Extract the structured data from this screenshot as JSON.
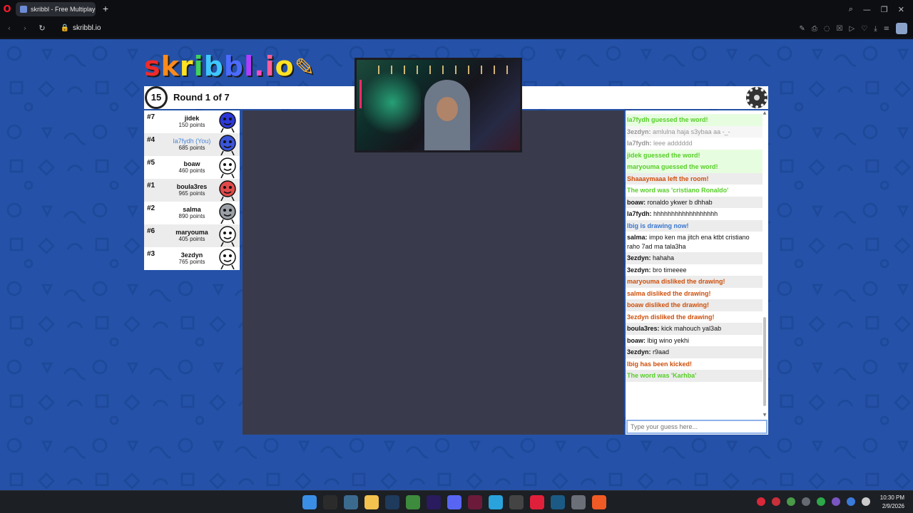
{
  "browser": {
    "tab_title": "skribbl - Free Multiplayer",
    "new_tab_symbol": "+",
    "url": "skribbl.io",
    "opera_logo": "O",
    "icons": [
      "back-arrow-icon",
      "forward-arrow-icon",
      "reload-icon",
      "lock-icon",
      "search-icon",
      "minimize-icon",
      "maximize-icon",
      "close-icon"
    ],
    "nav": {
      "back": "‹",
      "forward": "›",
      "reload": "↻",
      "lock": "🔒"
    },
    "win": {
      "search": "⌕",
      "min": "—",
      "max": "❐",
      "close": "✕"
    },
    "ext": [
      "✎",
      "⎙",
      "◌",
      "☒",
      "▷",
      "♡",
      "⤓",
      "≡"
    ]
  },
  "game": {
    "logo_letters": [
      {
        "ch": "s",
        "color": "#ef2a2a"
      },
      {
        "ch": "k",
        "color": "#ff8a1c"
      },
      {
        "ch": "r",
        "color": "#ffe223"
      },
      {
        "ch": "i",
        "color": "#3fd35a"
      },
      {
        "ch": "b",
        "color": "#3ec7ff"
      },
      {
        "ch": "b",
        "color": "#4c6bff"
      },
      {
        "ch": "l",
        "color": "#b13cff"
      },
      {
        "ch": ".",
        "color": "#ff4cc2"
      },
      {
        "ch": "i",
        "color": "#ff5d9a"
      },
      {
        "ch": "o",
        "color": "#ffe223"
      }
    ],
    "logo_pencil": "✎",
    "timer": "15",
    "round_text": "Round 1 of 7",
    "players": [
      {
        "rank": "#7",
        "name": "jidek",
        "points": "150 points",
        "you": false,
        "avatar_color": "#2e38d8"
      },
      {
        "rank": "#4",
        "name": "la7fydh (You)",
        "points": "685 points",
        "you": true,
        "avatar_color": "#3b55d9"
      },
      {
        "rank": "#5",
        "name": "boaw",
        "points": "460 points",
        "you": false,
        "avatar_color": "#ffffff"
      },
      {
        "rank": "#1",
        "name": "boula3res",
        "points": "965 points",
        "you": false,
        "avatar_color": "#e24a4a"
      },
      {
        "rank": "#2",
        "name": "salma",
        "points": "890 points",
        "you": false,
        "avatar_color": "#9aa0a6"
      },
      {
        "rank": "#6",
        "name": "maryouma",
        "points": "405 points",
        "you": false,
        "avatar_color": "#ffffff"
      },
      {
        "rank": "#3",
        "name": "3ezdyn",
        "points": "765 points",
        "you": false,
        "avatar_color": "#ffffff"
      }
    ],
    "chat": [
      {
        "user": "",
        "text": "la7fydh guessed the word!",
        "style": "green"
      },
      {
        "user": "3ezdyn:",
        "text": "amlulna haja s3ybaa aa -_-",
        "style": "faded"
      },
      {
        "user": "la7fydh:",
        "text": "leee adddddd",
        "style": "faded"
      },
      {
        "user": "",
        "text": "jidek guessed the word!",
        "style": "green"
      },
      {
        "user": "",
        "text": "maryouma guessed the word!",
        "style": "green"
      },
      {
        "user": "",
        "text": "Shaaaymaaa left the room!",
        "style": "red"
      },
      {
        "user": "",
        "text": "The word was 'cristiano Ronaldo'",
        "style": "green-text"
      },
      {
        "user": "boaw:",
        "text": "ronaldo ykwer b dhhab",
        "style": "normal"
      },
      {
        "user": "la7fydh:",
        "text": "hhhhhhhhhhhhhhhhhh",
        "style": "normal"
      },
      {
        "user": "",
        "text": "lbig is drawing now!",
        "style": "blue"
      },
      {
        "user": "salma:",
        "text": "impo ken ma jitch ena ktbt cristiano raho 7ad ma tala3ha",
        "style": "normal"
      },
      {
        "user": "3ezdyn:",
        "text": "hahaha",
        "style": "normal"
      },
      {
        "user": "3ezdyn:",
        "text": "bro timeeee",
        "style": "normal"
      },
      {
        "user": "",
        "text": "maryouma disliked the drawing!",
        "style": "red"
      },
      {
        "user": "",
        "text": "salma disliked the drawing!",
        "style": "red"
      },
      {
        "user": "",
        "text": "boaw disliked the drawing!",
        "style": "red"
      },
      {
        "user": "",
        "text": "3ezdyn disliked the drawing!",
        "style": "red"
      },
      {
        "user": "boula3res:",
        "text": "kick mahouch yal3ab",
        "style": "normal"
      },
      {
        "user": "boaw:",
        "text": "lbig wino yekhi",
        "style": "normal"
      },
      {
        "user": "3ezdyn:",
        "text": "r9aad",
        "style": "normal"
      },
      {
        "user": "",
        "text": "lbig has been kicked!",
        "style": "red"
      },
      {
        "user": "",
        "text": "The word was 'Karhba'",
        "style": "green-text"
      }
    ],
    "guess_placeholder": "Type your guess here..."
  },
  "taskbar": {
    "time": "10:30 PM",
    "date": "2/9/2026",
    "apps": [
      {
        "name": "windows-start-icon",
        "color": "#3a8ee6"
      },
      {
        "name": "epic-games-icon",
        "color": "#2b2b2b"
      },
      {
        "name": "snipping-tool-icon",
        "color": "#3b6a8f"
      },
      {
        "name": "file-explorer-icon",
        "color": "#f2c14e"
      },
      {
        "name": "lightroom-icon",
        "color": "#1e3a5c"
      },
      {
        "name": "xbox-icon",
        "color": "#3d8b3d"
      },
      {
        "name": "premiere-icon",
        "color": "#2a1a5e"
      },
      {
        "name": "discord-icon",
        "color": "#5865f2"
      },
      {
        "name": "vegas-icon",
        "color": "#6b1a3a"
      },
      {
        "name": "telegram-icon",
        "color": "#2aa3dc"
      },
      {
        "name": "obs-icon",
        "color": "#444444"
      },
      {
        "name": "opera-gx-icon",
        "color": "#e0203a"
      },
      {
        "name": "steam-icon",
        "color": "#1b5a85"
      },
      {
        "name": "settings-icon",
        "color": "#6b6f78"
      },
      {
        "name": "brave-icon",
        "color": "#f05a24"
      }
    ],
    "tray": [
      "#d9283a",
      "#c9303a",
      "#4a9a4a",
      "#666a72",
      "#2da84a",
      "#7a55c2",
      "#3a7ad9",
      "#cccccc"
    ]
  }
}
